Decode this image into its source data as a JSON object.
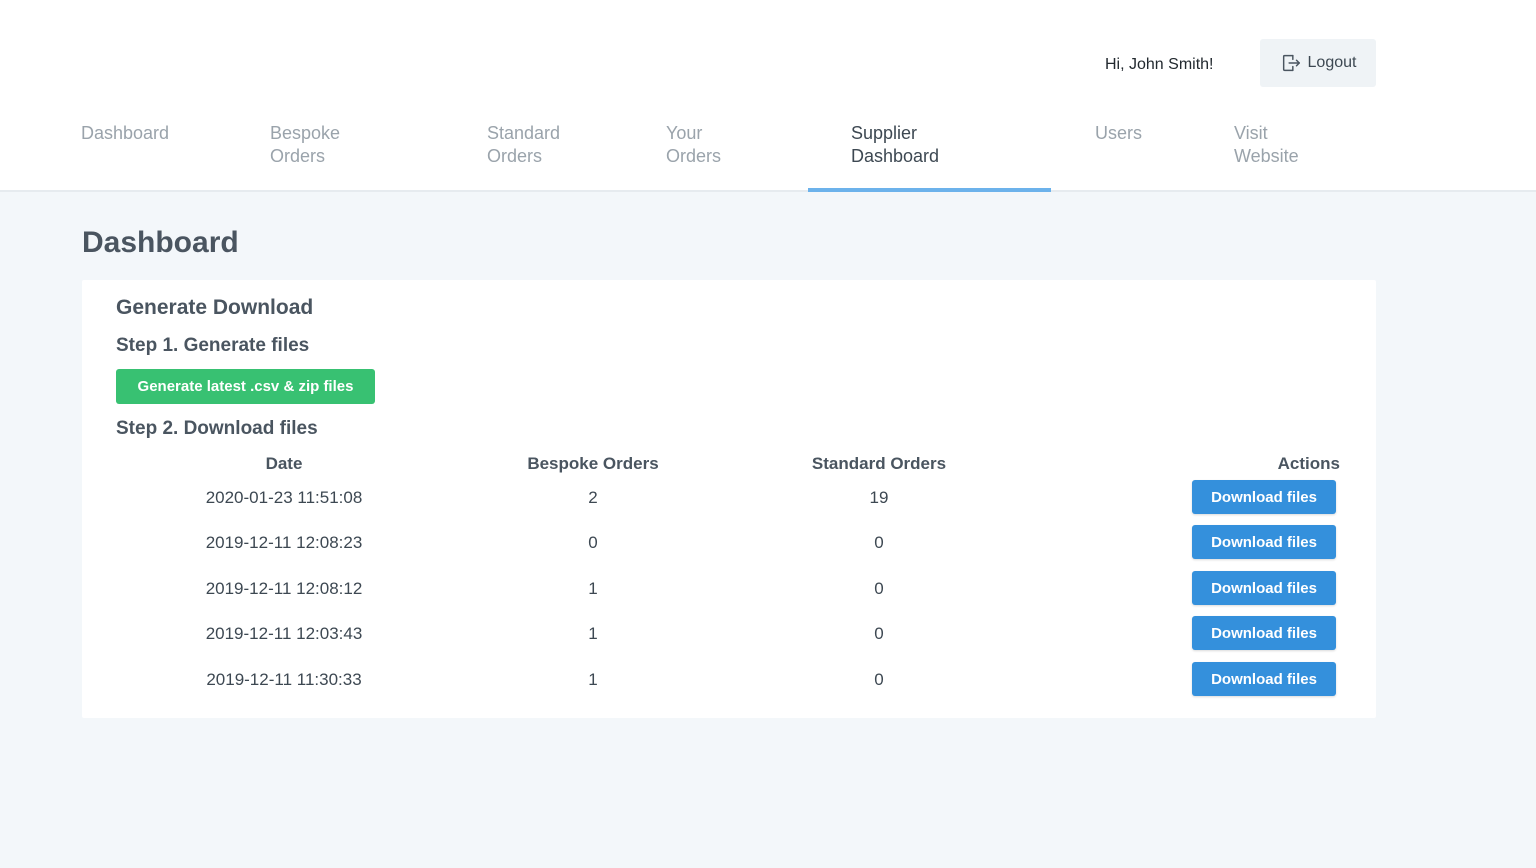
{
  "header": {
    "greeting": "Hi, John Smith!",
    "logout_label": "Logout",
    "logout_icon": "logout-icon"
  },
  "nav": {
    "items": [
      {
        "line1": "Dashboard",
        "line2": ""
      },
      {
        "line1": "Bespoke",
        "line2": "Orders"
      },
      {
        "line1": "Standard",
        "line2": "Orders"
      },
      {
        "line1": "Your",
        "line2": "Orders"
      },
      {
        "line1": "Supplier",
        "line2": "Dashboard"
      },
      {
        "line1": "Users",
        "line2": ""
      },
      {
        "line1": "Visit",
        "line2": "Website"
      }
    ],
    "active_index": 4
  },
  "page": {
    "title": "Dashboard"
  },
  "card": {
    "title": "Generate Download",
    "step1_title": "Step 1. Generate files",
    "generate_label": "Generate latest .csv & zip files",
    "step2_title": "Step 2. Download files"
  },
  "table": {
    "columns": [
      "Date",
      "Bespoke Orders",
      "Standard Orders",
      "Actions"
    ],
    "rows": [
      {
        "date": "2020-01-23 11:51:08",
        "bespoke": "2",
        "standard": "19",
        "action": "Download files"
      },
      {
        "date": "2019-12-11 12:08:23",
        "bespoke": "0",
        "standard": "0",
        "action": "Download files"
      },
      {
        "date": "2019-12-11 12:08:12",
        "bespoke": "1",
        "standard": "0",
        "action": "Download files"
      },
      {
        "date": "2019-12-11 12:03:43",
        "bespoke": "1",
        "standard": "0",
        "action": "Download files"
      },
      {
        "date": "2019-12-11 11:30:33",
        "bespoke": "1",
        "standard": "0",
        "action": "Download files"
      }
    ]
  },
  "colors": {
    "accent": "#6cb2eb",
    "green": "#38c172",
    "blue": "#3490dc"
  }
}
